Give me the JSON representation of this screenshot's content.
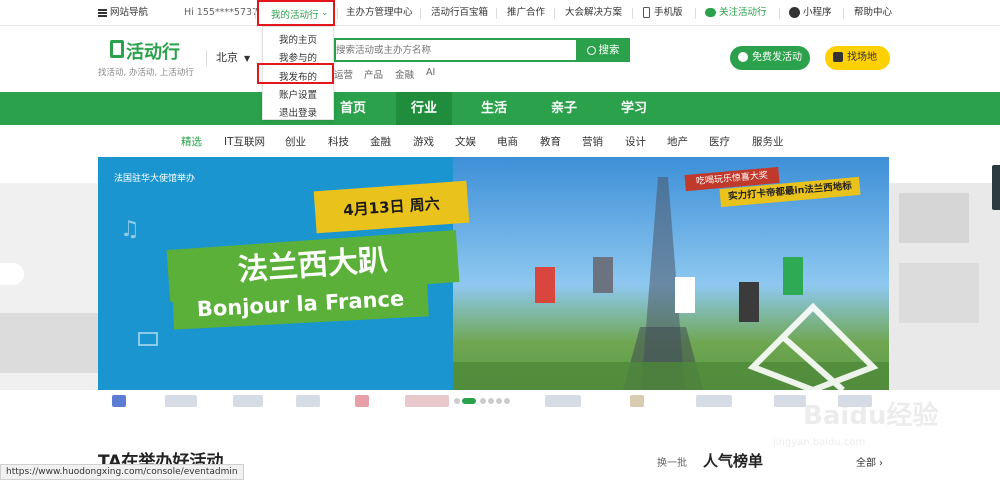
{
  "topbar": {
    "site_nav": "网站导航",
    "greeting": "Hi 155****5737",
    "my_activities": "我的活动行",
    "organizer_center": "主办方管理中心",
    "treasure": "活动行百宝箱",
    "promotion": "推广合作",
    "conference": "大会解决方案",
    "mobile": "手机版",
    "follow": "关注活动行",
    "mini_program": "小程序",
    "help": "帮助中心"
  },
  "dropdown": {
    "items": [
      "我的主页",
      "我参与的",
      "我发布的",
      "账户设置",
      "退出登录"
    ]
  },
  "header": {
    "logo_text": "活动行",
    "slogan": "找活动, 办活动, 上活动行",
    "city": "北京",
    "search_placeholder": "搜索活动或主办方名称",
    "search_button": "搜索",
    "hot_tags": [
      "运营",
      "产品",
      "金融",
      "AI"
    ],
    "publish_button": "免费发活动",
    "venue_button": "找场地"
  },
  "nav": {
    "items": [
      "首页",
      "行业",
      "生活",
      "亲子",
      "学习"
    ],
    "active": "行业"
  },
  "subnav": {
    "items": [
      "精选",
      "IT互联网",
      "创业",
      "科技",
      "金融",
      "游戏",
      "文娱",
      "电商",
      "教育",
      "营销",
      "设计",
      "地产",
      "医疗",
      "服务业"
    ],
    "active": "精选"
  },
  "banner": {
    "organizer": "法国驻华大使馆举办",
    "date": "4月13日 周六",
    "title_cn": "法兰西大趴",
    "title_fr": "Bonjour la France",
    "tagline_1": "吃喝玩乐惊喜大奖",
    "tagline_2": "实力打卡帝都最in法兰西地标"
  },
  "section": {
    "title": "TA在举办好活动",
    "refresh": "换一批",
    "rank_title": "人气榜单",
    "all_link": "全部"
  },
  "statusbar": {
    "url": "https://www.huodongxing.com/console/eventadmin"
  },
  "watermark": {
    "text": "Baidu经验",
    "sub": "jingyan.baidu.com"
  },
  "colors": {
    "brand_green": "#2aa14a",
    "highlight_red": "#e4161c",
    "venue_yellow": "#ffd000"
  }
}
